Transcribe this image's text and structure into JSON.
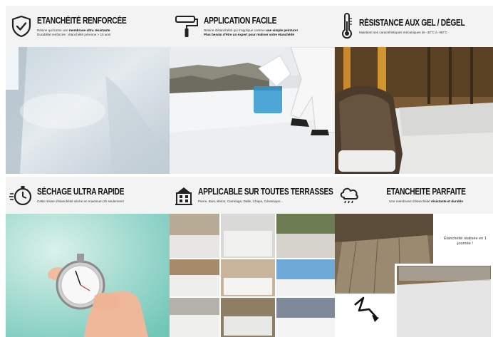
{
  "panels": [
    {
      "title": "ETANCHÉITÉ RENFORCÉE",
      "line1_a": "Résine qui forme une ",
      "line1_b": "membrane ultra résistante",
      "line2": "Durabilité renforcée : étanchéité pérenne > 10 ans!",
      "icon": "shield-check-icon"
    },
    {
      "title": "APPLICATION FACILE",
      "line1_a": "Résine d'étanchéité qui s'applique comme ",
      "line1_b": "une simple peinture!",
      "line2": "Plus besoin d'être un expert pour réaliser votre étanchéité",
      "icon": "paint-roller-icon"
    },
    {
      "title": "RÉSISTANCE AUX GEL / DÉGEL",
      "line1_a": "Maintient ses caractéristiques mécaniques de -30°C à +80°C",
      "icon": "thermometer-icon"
    },
    {
      "title": "SÉCHAGE ULTRA RAPIDE",
      "line1_a": "Cette résine d'étanchéité sèche en maximum 3h seulement!",
      "icon": "stopwatch-icon"
    },
    {
      "title": "APPLICABLE SUR TOUTES TERRASSES",
      "line1_a": "Pierre, Bois, Béton, Carrelage, Dalle, Chape, Céramique...",
      "icon": "building-icon"
    },
    {
      "title": "ETANCHEITE PARFAITE",
      "line1_a": "Une membrane d'étanchéité ",
      "line1_b": "résistante et durable",
      "icon": "rain-cloud-icon"
    }
  ],
  "overlay_note": "Étanchéité réalisée en 1 journée !"
}
